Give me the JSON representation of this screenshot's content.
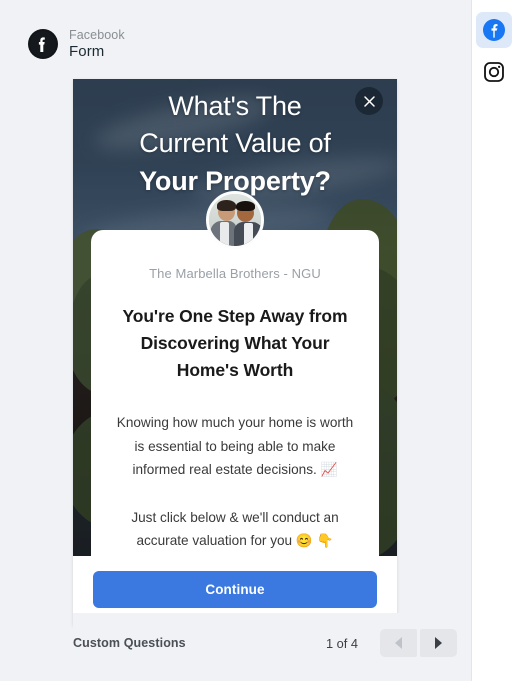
{
  "header": {
    "platform_label": "Facebook",
    "title": "Form",
    "logo_icon": "facebook-logo-icon"
  },
  "preview": {
    "close_icon": "close-icon",
    "hero_title_lines": [
      {
        "text": "What's The",
        "bold": false
      },
      {
        "text": "Current Value of",
        "bold": false
      },
      {
        "text": "Your Property?",
        "bold": true
      }
    ],
    "avatar_alt": "two-people-avatar",
    "brand_name": "The Marbella Brothers - NGU",
    "card_heading": "You're One Step Away from Discovering What Your Home's Worth",
    "paragraphs": [
      "Knowing how much your home is worth is essential to being able to make informed real estate decisions. 📈",
      "Just click below & we'll conduct an accurate valuation for you 😊 👇"
    ],
    "cta_label": "Continue"
  },
  "footer": {
    "section_label": "Custom Questions",
    "page_counter": "1 of 4",
    "prev_icon": "chevron-left-icon",
    "next_icon": "chevron-right-icon"
  },
  "side_rail": {
    "items": [
      {
        "name": "facebook",
        "icon": "facebook-icon",
        "active": true
      },
      {
        "name": "instagram",
        "icon": "instagram-icon",
        "active": false
      }
    ]
  },
  "colors": {
    "accent_blue": "#3b79e0",
    "panel_bg": "#f0f2f5",
    "rail_active_bg": "#dde8f8",
    "facebook_blue": "#1877f2"
  }
}
